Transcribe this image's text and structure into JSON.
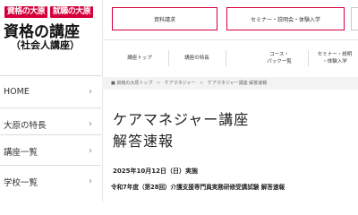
{
  "logo": {
    "tag_shikaku": "資格の大原",
    "tag_shushoku": "就職の大原",
    "main": "資格の講座",
    "sub": "（社会人講座）"
  },
  "sidebar": {
    "items": [
      {
        "label": "HOME"
      },
      {
        "label": "大原の特長"
      },
      {
        "label": "講座一覧"
      },
      {
        "label": "学校一覧"
      }
    ]
  },
  "header": {
    "request_button": "資料請求",
    "seminar_button": "セミナー・説明会・体験入学"
  },
  "global_nav": [
    {
      "label": "講座トップ"
    },
    {
      "label": "講座の特長"
    },
    {
      "label": "コース・\nパック一覧"
    },
    {
      "label": "セミナー・説明\n・体験入学"
    }
  ],
  "breadcrumb": {
    "home": "資格の大原トップ",
    "level2": "ケアマネジャー",
    "current": "ケアマネジャー講座 解答速報"
  },
  "main": {
    "title_line1": "ケアマネジャー講座",
    "title_line2": "解答速報",
    "exam_date": "2025年10月12日（日）実施",
    "exam_name": "令和7年度（第28回）介護支援専門員実務研修受講試験 解答速報"
  },
  "colors": {
    "brand": "#d5003b",
    "breadcrumb_bg": "#f3f3f3"
  }
}
